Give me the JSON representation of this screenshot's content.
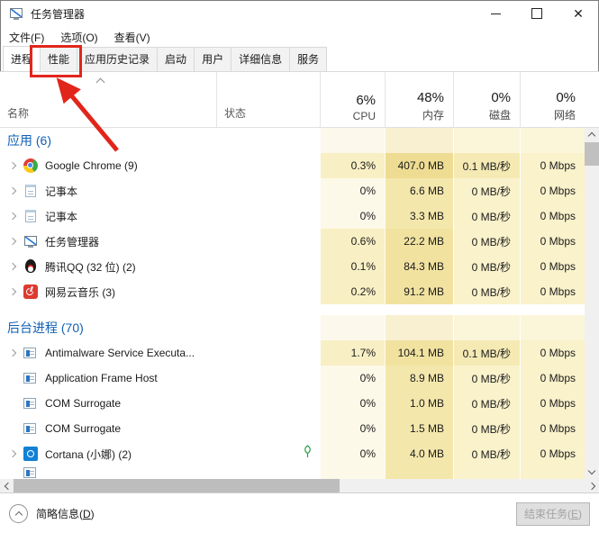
{
  "window": {
    "title": "任务管理器"
  },
  "menu": {
    "items": [
      "文件(F)",
      "选项(O)",
      "查看(V)"
    ]
  },
  "tabs": {
    "items": [
      {
        "label": "进程",
        "selected": true
      },
      {
        "label": "性能",
        "selected": false
      },
      {
        "label": "应用历史记录",
        "selected": false
      },
      {
        "label": "启动",
        "selected": false
      },
      {
        "label": "用户",
        "selected": false
      },
      {
        "label": "详细信息",
        "selected": false
      },
      {
        "label": "服务",
        "selected": false
      }
    ]
  },
  "annotation": {
    "color": "#e2251b",
    "target_tab": "性能"
  },
  "table": {
    "name_header": "名称",
    "status_header": "状态",
    "stat_headers": [
      {
        "pct": "6%",
        "label": "CPU"
      },
      {
        "pct": "48%",
        "label": "内存"
      },
      {
        "pct": "0%",
        "label": "磁盘"
      },
      {
        "pct": "0%",
        "label": "网络"
      }
    ],
    "groups": [
      {
        "label": "应用 (6)",
        "rows": [
          {
            "name": "Google Chrome (9)",
            "icon": "chrome",
            "expandable": true,
            "leaf": false,
            "cpu": "0.3%",
            "mem": "407.0 MB",
            "disk": "0.1 MB/秒",
            "net": "0 Mbps",
            "heat": {
              "cpu": "c1",
              "mem": "m3",
              "disk": "d1",
              "net": "d0"
            }
          },
          {
            "name": "记事本",
            "icon": "notepad",
            "expandable": true,
            "leaf": false,
            "cpu": "0%",
            "mem": "6.6 MB",
            "disk": "0 MB/秒",
            "net": "0 Mbps",
            "heat": {
              "cpu": "c0",
              "mem": "m1",
              "disk": "d0",
              "net": "d0"
            }
          },
          {
            "name": "记事本",
            "icon": "notepad",
            "expandable": true,
            "leaf": false,
            "cpu": "0%",
            "mem": "3.3 MB",
            "disk": "0 MB/秒",
            "net": "0 Mbps",
            "heat": {
              "cpu": "c0",
              "mem": "m1",
              "disk": "d0",
              "net": "d0"
            }
          },
          {
            "name": "任务管理器",
            "icon": "taskmgr",
            "expandable": true,
            "leaf": false,
            "cpu": "0.6%",
            "mem": "22.2 MB",
            "disk": "0 MB/秒",
            "net": "0 Mbps",
            "heat": {
              "cpu": "c1",
              "mem": "m2",
              "disk": "d0",
              "net": "d0"
            }
          },
          {
            "name": "腾讯QQ (32 位) (2)",
            "icon": "qq",
            "expandable": true,
            "leaf": false,
            "cpu": "0.1%",
            "mem": "84.3 MB",
            "disk": "0 MB/秒",
            "net": "0 Mbps",
            "heat": {
              "cpu": "c1",
              "mem": "m2",
              "disk": "d0",
              "net": "d0"
            }
          },
          {
            "name": "网易云音乐 (3)",
            "icon": "netease",
            "expandable": true,
            "leaf": false,
            "cpu": "0.2%",
            "mem": "91.2 MB",
            "disk": "0 MB/秒",
            "net": "0 Mbps",
            "heat": {
              "cpu": "c1",
              "mem": "m2",
              "disk": "d0",
              "net": "d0"
            }
          }
        ]
      },
      {
        "label": "后台进程 (70)",
        "rows": [
          {
            "name": "Antimalware Service Executa...",
            "icon": "generic",
            "expandable": true,
            "leaf": false,
            "cpu": "1.7%",
            "mem": "104.1 MB",
            "disk": "0.1 MB/秒",
            "net": "0 Mbps",
            "heat": {
              "cpu": "c1",
              "mem": "m2",
              "disk": "d1",
              "net": "d0"
            }
          },
          {
            "name": "Application Frame Host",
            "icon": "generic",
            "expandable": false,
            "leaf": false,
            "cpu": "0%",
            "mem": "8.9 MB",
            "disk": "0 MB/秒",
            "net": "0 Mbps",
            "heat": {
              "cpu": "c0",
              "mem": "m1",
              "disk": "d0",
              "net": "d0"
            }
          },
          {
            "name": "COM Surrogate",
            "icon": "generic",
            "expandable": false,
            "leaf": false,
            "cpu": "0%",
            "mem": "1.0 MB",
            "disk": "0 MB/秒",
            "net": "0 Mbps",
            "heat": {
              "cpu": "c0",
              "mem": "m1",
              "disk": "d0",
              "net": "d0"
            }
          },
          {
            "name": "COM Surrogate",
            "icon": "generic",
            "expandable": false,
            "leaf": false,
            "cpu": "0%",
            "mem": "1.5 MB",
            "disk": "0 MB/秒",
            "net": "0 Mbps",
            "heat": {
              "cpu": "c0",
              "mem": "m1",
              "disk": "d0",
              "net": "d0"
            }
          },
          {
            "name": "Cortana (小娜) (2)",
            "icon": "cortana",
            "expandable": true,
            "leaf": true,
            "cpu": "0%",
            "mem": "4.0 MB",
            "disk": "0 MB/秒",
            "net": "0 Mbps",
            "heat": {
              "cpu": "c0",
              "mem": "m1",
              "disk": "d0",
              "net": "d0"
            }
          }
        ]
      }
    ],
    "partial_row": {
      "name": "",
      "icon": "generic",
      "expandable": false,
      "leaf": false,
      "cpu": "",
      "mem": "",
      "disk": "",
      "net": "",
      "heat": {
        "cpu": "c0",
        "mem": "m1",
        "disk": "d0",
        "net": "d0"
      }
    }
  },
  "footer": {
    "details_pre": "简略信息(",
    "details_key": "D",
    "details_post": ")",
    "end_task_pre": "结束任务(",
    "end_task_key": "E",
    "end_task_post": ")"
  },
  "colors": {
    "section_label": "#1160b6",
    "leaf_green": "#2e9e49",
    "heat": {
      "c0": "#fdf9e9",
      "c1": "#f8efc4",
      "m1": "#f4e7ac",
      "m2": "#f1e2a0",
      "m3": "#eedc92",
      "d0": "#faf2cb",
      "d1": "#f5eab4",
      "hdr_cpu": "#fcf9ec",
      "hdr_mem": "#f8f0d0",
      "hdr_disk": "#fbf5d9",
      "hdr_net": "#fbf5d9"
    }
  }
}
